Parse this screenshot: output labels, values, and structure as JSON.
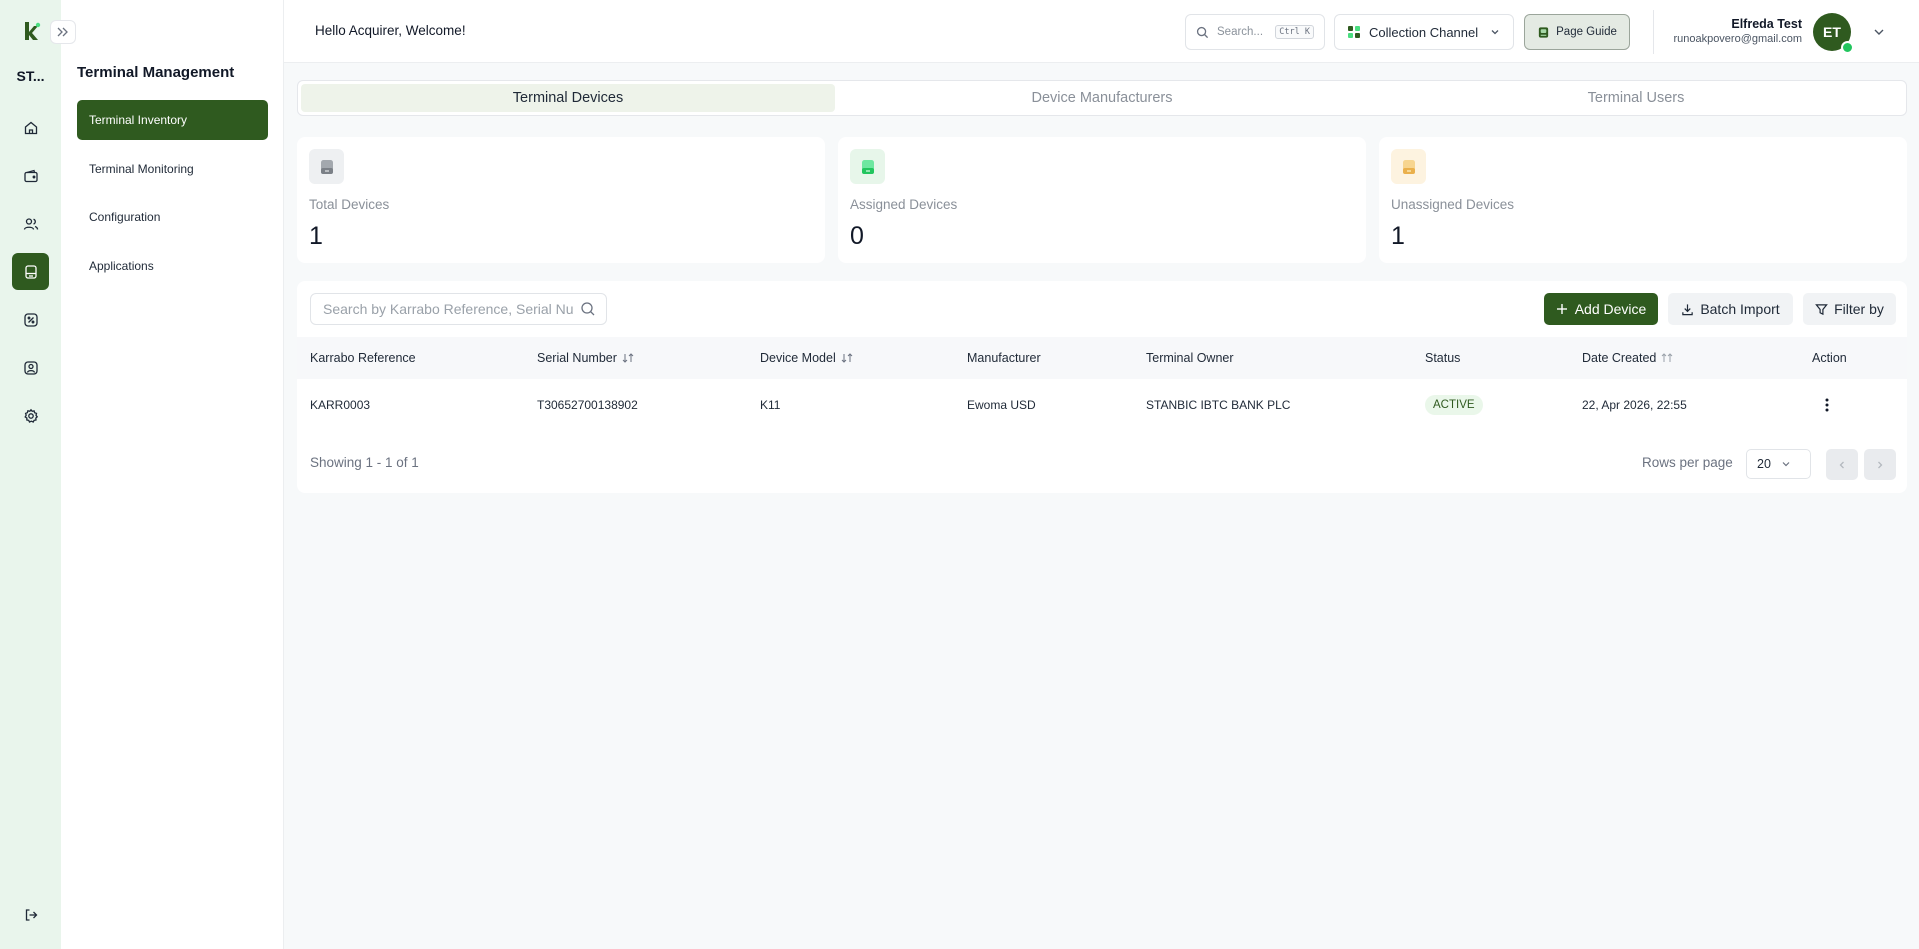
{
  "rail": {
    "org_short": "ST...",
    "items": [
      "home",
      "wallet",
      "users",
      "terminal",
      "percent",
      "user-profile",
      "settings"
    ],
    "active_item": "terminal"
  },
  "subnav": {
    "title": "Terminal Management",
    "items": [
      {
        "label": "Terminal Inventory",
        "active": true
      },
      {
        "label": "Terminal Monitoring",
        "active": false
      },
      {
        "label": "Configuration",
        "active": false
      },
      {
        "label": "Applications",
        "active": false
      }
    ]
  },
  "header": {
    "greeting": "Hello Acquirer, Welcome!",
    "search_placeholder": "Search...",
    "search_shortcut": "Ctrl K",
    "channel_label": "Collection Channel",
    "page_guide_label": "Page Guide",
    "user_name": "Elfreda Test",
    "user_email": "runoakpovero@gmail.com",
    "user_initials": "ET"
  },
  "tabs": [
    {
      "label": "Terminal Devices",
      "active": true
    },
    {
      "label": "Device Manufacturers",
      "active": false
    },
    {
      "label": "Terminal Users",
      "active": false
    }
  ],
  "stats": [
    {
      "label": "Total Devices",
      "value": "1",
      "icon": "device-gray-icon",
      "color": "#9ca3af",
      "bg": "#eef0f2"
    },
    {
      "label": "Assigned Devices",
      "value": "0",
      "icon": "device-green-icon",
      "color": "#4ade80",
      "bg": "#e7f6ea"
    },
    {
      "label": "Unassigned Devices",
      "value": "1",
      "icon": "device-amber-icon",
      "color": "#f4c56a",
      "bg": "#fdf3e0"
    }
  ],
  "table": {
    "search_placeholder": "Search by Karrabo Reference, Serial Nu",
    "add_label": "Add Device",
    "batch_label": "Batch Import",
    "filter_label": "Filter by",
    "columns": [
      "Karrabo Reference",
      "Serial Number",
      "Device Model",
      "Manufacturer",
      "Terminal Owner",
      "Status",
      "Date Created",
      "Action"
    ],
    "rows": [
      {
        "reference": "KARR0003",
        "serial": "T30652700138902",
        "model": "K11",
        "manufacturer": "Ewoma USD",
        "owner": "STANBIC IBTC BANK PLC",
        "status": "ACTIVE",
        "created": "22, Apr 2026, 22:55"
      }
    ],
    "showing": "Showing 1 - 1 of 1",
    "rows_per_page_label": "Rows per page",
    "rows_per_page": "20"
  },
  "colors": {
    "brand": "#2f5a1f",
    "rail_bg": "#e9f5ec",
    "status_active_bg": "#eaf7ea"
  }
}
